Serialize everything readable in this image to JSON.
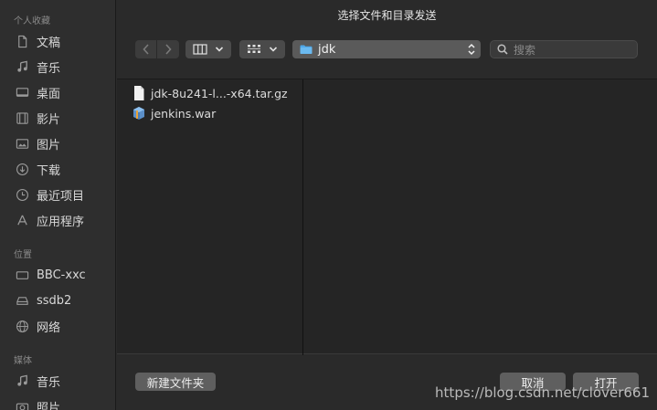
{
  "dialog": {
    "title": "选择文件和目录发送"
  },
  "sidebar": {
    "favorites_header": "个人收藏",
    "favorites": [
      {
        "label": "文稿",
        "icon": "document-icon"
      },
      {
        "label": "音乐",
        "icon": "music-icon"
      },
      {
        "label": "桌面",
        "icon": "desktop-icon"
      },
      {
        "label": "影片",
        "icon": "film-icon"
      },
      {
        "label": "图片",
        "icon": "photo-icon"
      },
      {
        "label": "下载",
        "icon": "download-icon"
      },
      {
        "label": "最近项目",
        "icon": "clock-icon"
      },
      {
        "label": "应用程序",
        "icon": "apps-icon"
      }
    ],
    "locations_header": "位置",
    "locations": [
      {
        "label": "BBC-xxc",
        "icon": "computer-icon"
      },
      {
        "label": "ssdb2",
        "icon": "drive-icon"
      },
      {
        "label": "网络",
        "icon": "network-icon"
      }
    ],
    "media_header": "媒体",
    "media": [
      {
        "label": "音乐",
        "icon": "music-icon"
      },
      {
        "label": "照片",
        "icon": "camera-icon"
      }
    ]
  },
  "toolbar": {
    "path": "jdk",
    "search_placeholder": "搜索"
  },
  "files": [
    {
      "name": "jdk-8u241-l...-x64.tar.gz",
      "icon": "archive-icon"
    },
    {
      "name": "jenkins.war",
      "icon": "package-icon"
    }
  ],
  "buttons": {
    "new_folder": "新建文件夹",
    "cancel": "取消",
    "open": "打开"
  },
  "watermark": "https://blog.csdn.net/clover661",
  "colors": {
    "accent_folder": "#4fa8e8",
    "background": "#2a2a2a",
    "sidebar": "#2e2e2e"
  }
}
